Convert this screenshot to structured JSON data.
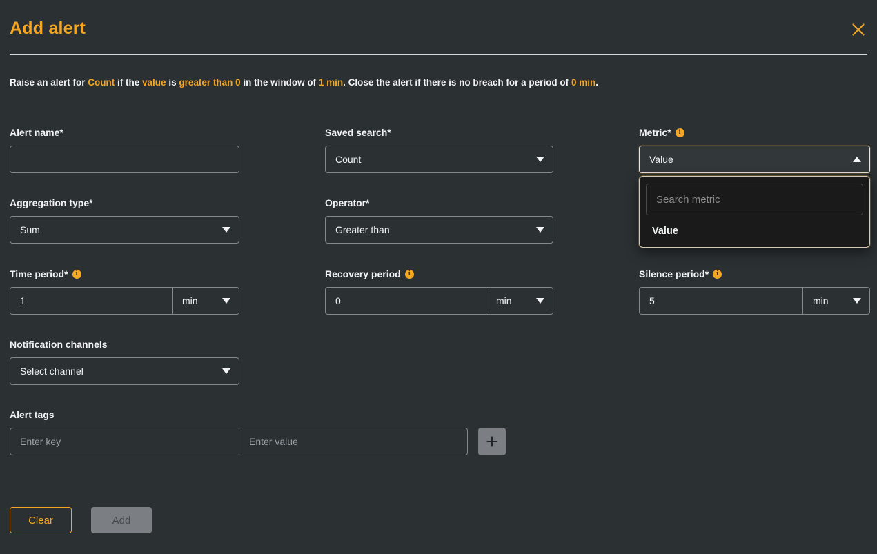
{
  "header": {
    "title": "Add alert",
    "close_icon": "close-icon"
  },
  "summary": {
    "p1": "Raise an alert for ",
    "saved_search": "Count",
    "p2": " if the ",
    "metric": "value",
    "p3": " is ",
    "operator_value": "greater than 0",
    "p4": " in the window of ",
    "time_period": "1 min",
    "p5": ". Close the alert if there is no breach for a period of ",
    "recovery_period": "0 min",
    "p6": "."
  },
  "fields": {
    "alert_name": {
      "label": "Alert name*",
      "value": "",
      "placeholder": ""
    },
    "saved_search": {
      "label": "Saved search*",
      "value": "Count"
    },
    "metric": {
      "label": "Metric*",
      "value": "Value",
      "info_icon": "info-icon",
      "open": true,
      "search_placeholder": "Search metric",
      "search_value": "",
      "options": [
        "Value"
      ]
    },
    "aggregation_type": {
      "label": "Aggregation type*",
      "value": "Sum"
    },
    "operator": {
      "label": "Operator*",
      "value": "Greater than"
    },
    "time_period": {
      "label": "Time period*",
      "value": "1",
      "unit": "min",
      "info_icon": "info-icon"
    },
    "recovery_period": {
      "label": "Recovery period",
      "value": "0",
      "unit": "min",
      "info_icon": "info-icon"
    },
    "silence_period": {
      "label": "Silence period*",
      "value": "5",
      "unit": "min",
      "info_icon": "info-icon"
    },
    "notification_channels": {
      "label": "Notification channels",
      "value": "Select channel"
    },
    "alert_tags": {
      "label": "Alert tags",
      "key_placeholder": "Enter key",
      "key_value": "",
      "value_placeholder": "Enter value",
      "value_value": "",
      "add_icon": "plus-icon"
    }
  },
  "buttons": {
    "clear": "Clear",
    "add": "Add"
  },
  "colors": {
    "accent": "#f5a623",
    "background": "#2b3033",
    "text": "#f1f3f4",
    "border": "#83888c",
    "popup_bg": "#1a1a1a",
    "disabled_btn": "#7b7f83"
  }
}
